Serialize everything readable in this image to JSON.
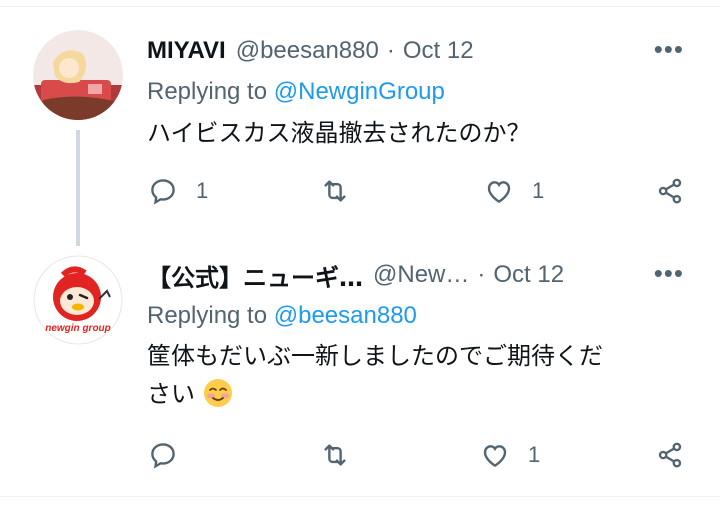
{
  "tweets": [
    {
      "name": "MIYAVI",
      "handle": "@beesan880",
      "separator": "·",
      "date": "Oct 12",
      "more": "•••",
      "replying_prefix": "Replying to",
      "replying_to": "@NewginGroup",
      "text": "ハイビスカス液晶撤去されたのか？",
      "actions": {
        "reply_count": "1",
        "retweet_count": "",
        "like_count": "1"
      }
    },
    {
      "name": "【公式】ニューギ…",
      "handle": "@New…",
      "separator": "·",
      "date": "Oct 12",
      "more": "•••",
      "replying_prefix": "Replying to",
      "replying_to": "@beesan880",
      "text_line1": "筐体もだいぶ一新しましたのでご期待くだ",
      "text_line2": "さい",
      "logo_text": "newgin group",
      "actions": {
        "reply_count": "",
        "retweet_count": "",
        "like_count": "1"
      }
    }
  ],
  "icons": [
    "reply-icon",
    "retweet-icon",
    "like-icon",
    "share-icon",
    "more-icon",
    "smiling-face-emoji"
  ],
  "colors": {
    "text": "#0f1419",
    "secondary": "#536471",
    "link": "#1d9bf0",
    "thread_line": "#cfd9de",
    "divider": "#eff3f4"
  }
}
